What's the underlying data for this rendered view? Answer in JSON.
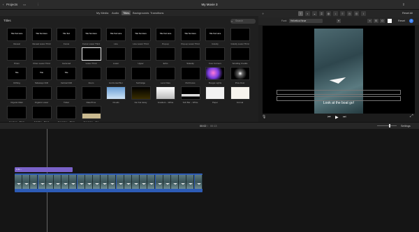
{
  "app": {
    "projects_label": "Projects",
    "title": "My Movie 3",
    "reset_all_label": "Reset All"
  },
  "tabs": [
    {
      "label": "My Media",
      "active": false
    },
    {
      "label": "Audio",
      "active": false
    },
    {
      "label": "Titles",
      "active": true
    },
    {
      "label": "Backgrounds",
      "active": false
    },
    {
      "label": "Transitions",
      "active": false
    }
  ],
  "browser": {
    "header": "Titles",
    "search_placeholder": "Search",
    "search_icon": "search-icon",
    "tiles": [
      {
        "name": "Reveal",
        "preview": "Title Text Here"
      },
      {
        "name": "Reveal Lower Third",
        "preview": "Title Text Here"
      },
      {
        "name": "Focus",
        "preview": "Title Text"
      },
      {
        "name": "Focus Lower Third",
        "preview": "Title Text Here"
      },
      {
        "name": "Line",
        "preview": "Title Text Here"
      },
      {
        "name": "Line Lower Third",
        "preview": "Title Text Here"
      },
      {
        "name": "Pop-up",
        "preview": "Title Text Here"
      },
      {
        "name": "Pop-up Lower Third",
        "preview": "Title Text Here"
      },
      {
        "name": "Gravity",
        "preview": "Title Text Here"
      },
      {
        "name": "Gravity Lower Third",
        "preview": ""
      },
      {
        "name": "Prism",
        "preview": ""
      },
      {
        "name": "Prism Lower Third",
        "preview": ""
      },
      {
        "name": "Centered",
        "preview": ""
      },
      {
        "name": "Lower Third",
        "preview": ""
      },
      {
        "name": "Lower",
        "preview": ""
      },
      {
        "name": "Upper",
        "preview": ""
      },
      {
        "name": "Echo",
        "preview": ""
      },
      {
        "name": "Sideslip",
        "preview": ""
      },
      {
        "name": "Four Corners",
        "preview": ""
      },
      {
        "name": "Scrolling Credits",
        "preview": ""
      },
      {
        "name": "Drifting",
        "preview": "Title"
      },
      {
        "name": "Sideways Drift",
        "preview": "Title"
      },
      {
        "name": "Vertical Drift",
        "preview": "Title"
      },
      {
        "name": "Zoom",
        "preview": ""
      },
      {
        "name": "Horizontal Blur",
        "preview": ""
      },
      {
        "name": "Soft Edge",
        "preview": ""
      },
      {
        "name": "Lens Flare",
        "preview": ""
      },
      {
        "name": "Pull Focus",
        "preview": ""
      },
      {
        "name": "Boogie Lights",
        "preview": ""
      },
      {
        "name": "Pixie Dust",
        "preview": ""
      },
      {
        "name": "Organic Main",
        "preview": ""
      },
      {
        "name": "Organic Lower",
        "preview": ""
      },
      {
        "name": "Ticket",
        "preview": ""
      },
      {
        "name": "Date/Time",
        "preview": ""
      },
      {
        "name": "Clouds",
        "preview": ""
      },
      {
        "name": "Far Far Away",
        "preview": ""
      },
      {
        "name": "Gradient – White",
        "preview": ""
      },
      {
        "name": "Soft Bar – White",
        "preview": ""
      },
      {
        "name": "Paper",
        "preview": ""
      },
      {
        "name": "Formal",
        "preview": ""
      },
      {
        "name": "Gradient – Black",
        "preview": ""
      },
      {
        "name": "Soft Bar – Black",
        "preview": ""
      },
      {
        "name": "Torn Edge – Black",
        "preview": ""
      },
      {
        "name": "Torn Edge – Tan",
        "preview": ""
      }
    ]
  },
  "inspector": {
    "font_label": "Font:",
    "font_value": "Helvetica Neue",
    "reset_label": "Reset"
  },
  "viewer": {
    "subtitle": "Look at the boat go!",
    "time_current": "00:02",
    "time_total": "00:13"
  },
  "timeline": {
    "settings_label": "Settings",
    "title_clip_label": "1.0s –",
    "frame_count": 24
  },
  "colors": {
    "title_clip": "#7a62c9",
    "video_clip": "#2d5bb5",
    "accent": "#3b82f6"
  }
}
